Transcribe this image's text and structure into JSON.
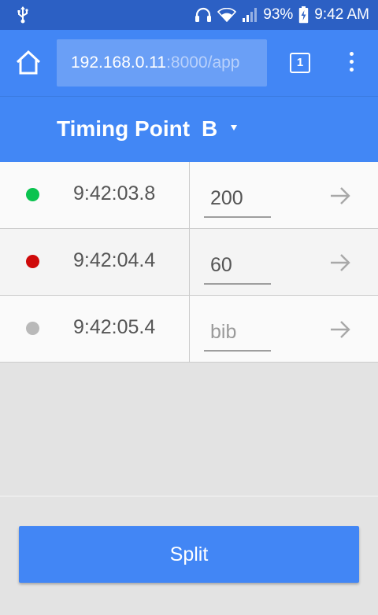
{
  "status_bar": {
    "battery_percent": "93%",
    "time": "9:42 AM",
    "icons": [
      "usb-icon",
      "headphones-icon",
      "wifi-icon",
      "signal-icon",
      "battery-charging-icon"
    ]
  },
  "browser": {
    "url_host": "192.168.0.11",
    "url_rest": ":8000/app",
    "tab_count": "1",
    "icons": [
      "home-icon",
      "tabs-icon",
      "more-vert-icon"
    ]
  },
  "header": {
    "label": "Timing Point",
    "value": "B",
    "caret_icon": "caret-down-icon"
  },
  "entries": [
    {
      "status_color": "#0ac34f",
      "time": "9:42:03.8",
      "bib_value": "200",
      "bib_placeholder": "bib"
    },
    {
      "status_color": "#cf0a0a",
      "time": "9:42:04.4",
      "bib_value": "60",
      "bib_placeholder": "bib"
    },
    {
      "status_color": "#b9b9b9",
      "time": "9:42:05.4",
      "bib_value": "",
      "bib_placeholder": "bib"
    }
  ],
  "actions": {
    "split_label": "Split"
  },
  "colors": {
    "status_bar": "#2c60c4",
    "toolbar": "#4286f5",
    "url_box": "#6a9ff6",
    "background": "#e3e3e3"
  }
}
